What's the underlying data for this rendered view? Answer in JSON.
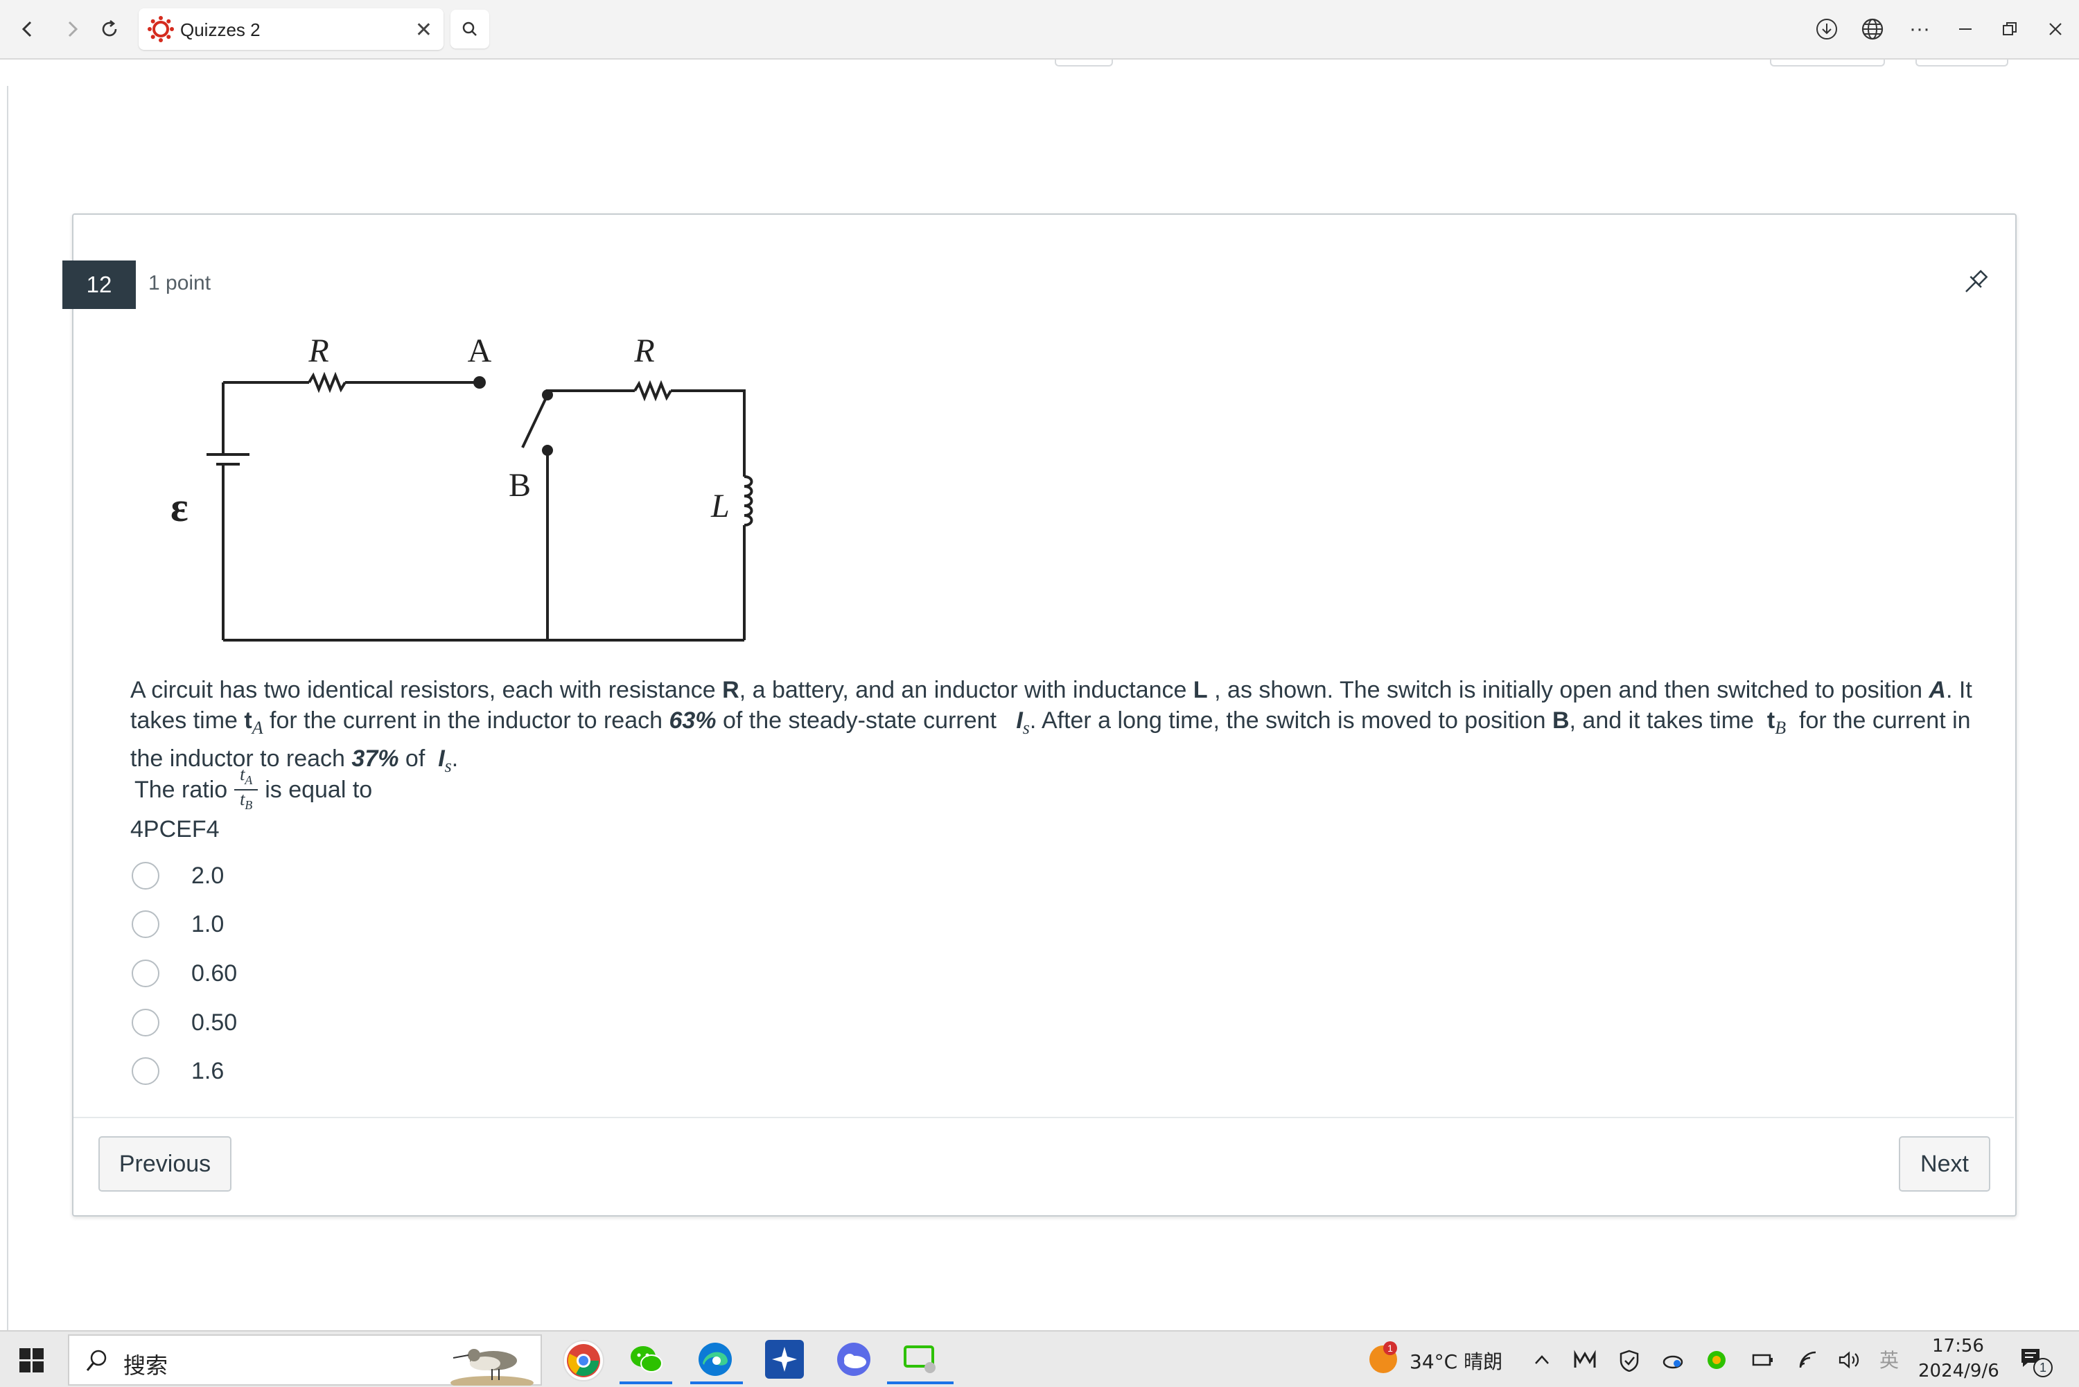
{
  "browser": {
    "tab_title": "Quizzes 2",
    "tab_close": "✕",
    "more_label": "···"
  },
  "question": {
    "number": "12",
    "points": "1 point",
    "text_parts": {
      "p1": "A circuit has two identical resistors, each with resistance ",
      "r": "R",
      "p2": ", a battery, and an inductor with inductance ",
      "l": "L",
      "p3": " , as shown.  The switch is initially open and then switched to position ",
      "a": "A",
      "p4": ". It takes time ",
      "ta_t": "t",
      "ta_sub": "A",
      "p5": " for the current in the inductor to reach ",
      "pct1": "63%",
      "p6": " of the steady-state current ",
      "is_i": "I",
      "is_sub": "s",
      "p7": ".  After a long time, the switch is moved to position ",
      "b": "B",
      "p8": ", and it takes time ",
      "tb_t": "t",
      "tb_sub": "B",
      "p9": " for the current in the inductor to reach ",
      "pct2": "37%",
      "p10": " of ",
      "is2_i": "I",
      "is2_sub": "s",
      "p11": "."
    },
    "ratio_prefix": "The ratio",
    "ratio_num": "tA",
    "ratio_den": "tB",
    "ratio_suffix": "is equal to",
    "code": "4PCEF4",
    "answers": [
      "2.0",
      "1.0",
      "0.60",
      "0.50",
      "1.6"
    ]
  },
  "circuit": {
    "label_r1": "R",
    "label_a": "A",
    "label_r2": "R",
    "label_b": "B",
    "label_emf": "ε",
    "label_l": "L"
  },
  "navigation": {
    "previous_label": "Previous",
    "next_label": "Next"
  },
  "taskbar": {
    "search_label": "搜索",
    "weather_badge": "1",
    "weather_text": "34°C  晴朗",
    "ime_label": "英",
    "time": "17:56",
    "date": "2024/9/6",
    "notification_count": "1"
  },
  "colors": {
    "question_badge_bg": "#2d3b45",
    "text": "#2d3b45",
    "border": "#c7cdd1",
    "taskbar_bg": "#eaeaea"
  }
}
